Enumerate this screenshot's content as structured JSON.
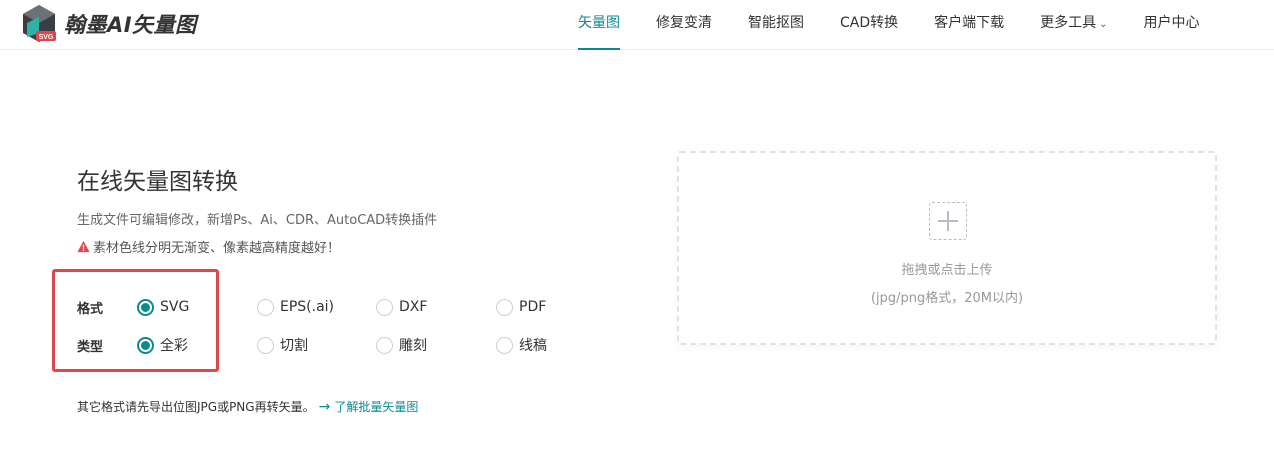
{
  "header": {
    "logo_text": "翰墨AI矢量图",
    "logo_badge": "SVG",
    "nav": [
      {
        "label": "矢量图",
        "active": true
      },
      {
        "label": "修复变清"
      },
      {
        "label": "智能抠图"
      },
      {
        "label": "CAD转换"
      },
      {
        "label": "客户端下载"
      },
      {
        "label": "更多工具"
      },
      {
        "label": "用户中心"
      }
    ]
  },
  "main": {
    "title": "在线矢量图转换",
    "description": "生成文件可编辑修改，新增Ps、Ai、CDR、AutoCAD转换插件",
    "warning": "素材色线分明无渐变、像素越高精度越好！",
    "format": {
      "label": "格式",
      "options": [
        "SVG",
        "EPS(.ai)",
        "DXF",
        "PDF"
      ],
      "selected": "SVG"
    },
    "type": {
      "label": "类型",
      "options": [
        "全彩",
        "切割",
        "雕刻",
        "线稿"
      ],
      "selected": "全彩"
    },
    "footer_note": "其它格式请先导出位图JPG或PNG再转矢量。",
    "learn_link": "了解批量矢量图"
  },
  "upload": {
    "prompt": "拖拽或点击上传",
    "hint": "(jpg/png格式，20M以内)"
  },
  "colors": {
    "accent": "#0b8a8f",
    "highlight_border": "#e0464a",
    "warning_icon": "#e0464a"
  }
}
